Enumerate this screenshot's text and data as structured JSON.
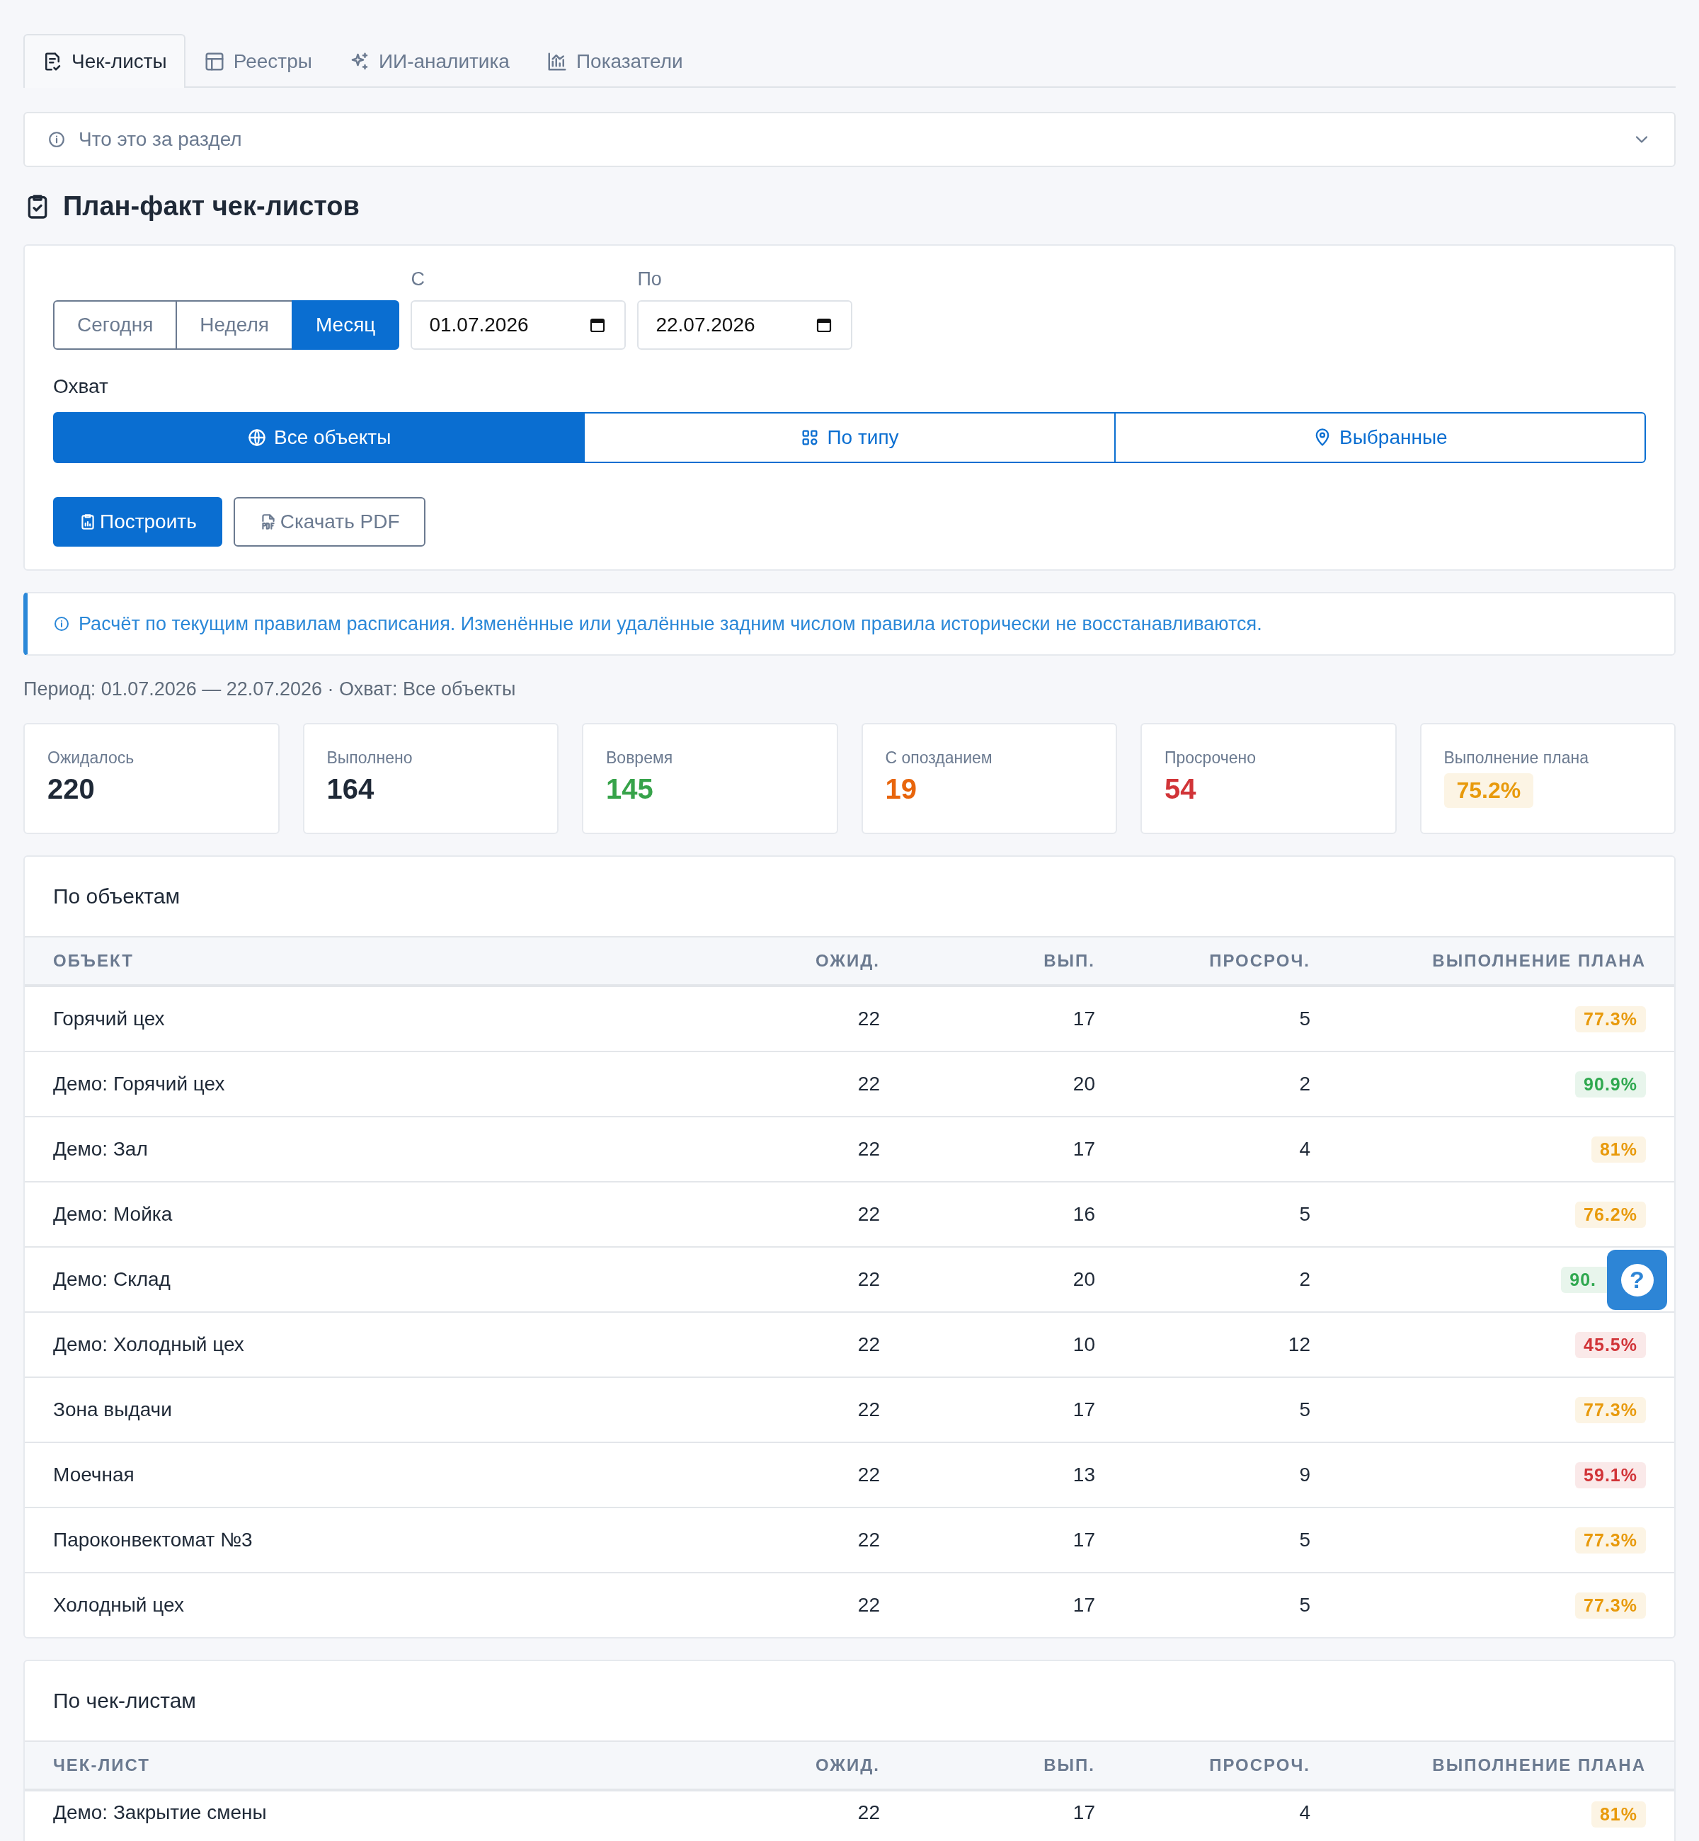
{
  "tabs": [
    {
      "label": "Чек-листы",
      "selected": true
    },
    {
      "label": "Реестры",
      "selected": false
    },
    {
      "label": "ИИ-аналитика",
      "selected": false
    },
    {
      "label": "Показатели",
      "selected": false
    }
  ],
  "info_panel": {
    "label": "Что это за раздел",
    "expanded": false
  },
  "title": "План-факт чек-листов",
  "filters": {
    "presets": [
      {
        "label": "Сегодня",
        "selected": false
      },
      {
        "label": "Неделя",
        "selected": false
      },
      {
        "label": "Месяц",
        "selected": true
      }
    ],
    "date_from": {
      "label": "С",
      "value": "01.07.2026"
    },
    "date_to": {
      "label": "По",
      "value": "22.07.2026"
    },
    "scope_label": "Охват",
    "scope": [
      {
        "label": "Все объекты",
        "selected": true
      },
      {
        "label": "По типу",
        "selected": false
      },
      {
        "label": "Выбранные",
        "selected": false
      }
    ],
    "actions": [
      {
        "label": "Построить",
        "kind": "primary"
      },
      {
        "label": "Скачать PDF",
        "kind": "secondary"
      }
    ]
  },
  "notice": "Расчёт по текущим правилам расписания. Изменённые или удалённые задним числом правила исторически не восстанавливаются.",
  "period_summary": "Период: 01.07.2026 — 22.07.2026 · Охват: Все объекты",
  "stats": [
    {
      "label": "Ожидалось",
      "value": "220",
      "color": "#1f2937",
      "kind": "number"
    },
    {
      "label": "Выполнено",
      "value": "164",
      "color": "#1f2937",
      "kind": "number"
    },
    {
      "label": "Вовремя",
      "value": "145",
      "color": "#37a34a",
      "kind": "number"
    },
    {
      "label": "С опозданием",
      "value": "19",
      "color": "#e8650c",
      "kind": "number"
    },
    {
      "label": "Просрочено",
      "value": "54",
      "color": "#d13438",
      "kind": "number"
    },
    {
      "label": "Выполнение плана",
      "value": "75.2%",
      "color": "#e89a0c",
      "kind": "badge"
    }
  ],
  "tables": [
    {
      "title": "По объектам",
      "columns": [
        "ОБЪЕКТ",
        "ОЖИД.",
        "ВЫП.",
        "ПРОСРОЧ.",
        "ВЫПОЛНЕНИЕ ПЛАНА"
      ],
      "rows": [
        {
          "name": "Горячий цех",
          "expected": "22",
          "done": "17",
          "overdue": "5",
          "plan": "77.3%",
          "color": "#e89a0c",
          "covered": false
        },
        {
          "name": "Демо: Горячий цех",
          "expected": "22",
          "done": "20",
          "overdue": "2",
          "plan": "90.9%",
          "color": "#2fa84f",
          "covered": false
        },
        {
          "name": "Демо: Зал",
          "expected": "22",
          "done": "17",
          "overdue": "4",
          "plan": "81%",
          "color": "#e89a0c",
          "covered": false
        },
        {
          "name": "Демо: Мойка",
          "expected": "22",
          "done": "16",
          "overdue": "5",
          "plan": "76.2%",
          "color": "#e89a0c",
          "covered": false
        },
        {
          "name": "Демо: Склад",
          "expected": "22",
          "done": "20",
          "overdue": "2",
          "plan": "90.",
          "color": "#2fa84f",
          "covered": true
        },
        {
          "name": "Демо: Холодный цех",
          "expected": "22",
          "done": "10",
          "overdue": "12",
          "plan": "45.5%",
          "color": "#d13438",
          "covered": false
        },
        {
          "name": "Зона выдачи",
          "expected": "22",
          "done": "17",
          "overdue": "5",
          "plan": "77.3%",
          "color": "#e89a0c",
          "covered": false
        },
        {
          "name": "Моечная",
          "expected": "22",
          "done": "13",
          "overdue": "9",
          "plan": "59.1%",
          "color": "#d13438",
          "covered": false
        },
        {
          "name": "Пароконвектомат №3",
          "expected": "22",
          "done": "17",
          "overdue": "5",
          "plan": "77.3%",
          "color": "#e89a0c",
          "covered": false
        },
        {
          "name": "Холодный цех",
          "expected": "22",
          "done": "17",
          "overdue": "5",
          "plan": "77.3%",
          "color": "#e89a0c",
          "covered": false
        }
      ]
    },
    {
      "title": "По чек-листам",
      "columns": [
        "ЧЕК-ЛИСТ",
        "ОЖИД.",
        "ВЫП.",
        "ПРОСРОЧ.",
        "ВЫПОЛНЕНИЕ ПЛАНА"
      ],
      "rows": [
        {
          "name": "Демо: Закрытие смены",
          "expected": "22",
          "done": "17",
          "overdue": "4",
          "plan": "81%",
          "color": "#e89a0c",
          "covered": false
        }
      ]
    }
  ],
  "help_button": "?"
}
